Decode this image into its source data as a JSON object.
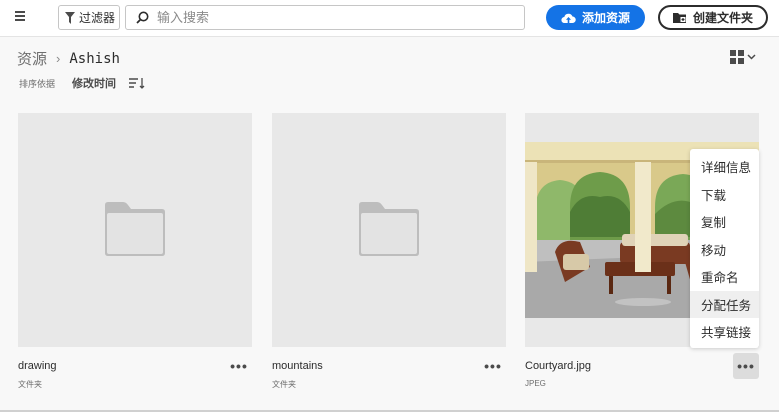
{
  "toolbar": {
    "menu_icon": "hamburger-icon",
    "filter_label": "过滤器",
    "filter_icon": "funnel-icon",
    "search_placeholder": "输入搜索",
    "search_value": "",
    "add_asset_label": "添加资源",
    "add_asset_icon": "cloud-upload-icon",
    "new_folder_label": "创建文件夹",
    "new_folder_icon": "folder-plus-icon",
    "accent_color": "#1473e6"
  },
  "breadcrumb": {
    "root": "资源",
    "current": "Ashish"
  },
  "sort": {
    "label": "排序依据",
    "value": "修改时间",
    "direction_icon": "sort-descending-icon"
  },
  "view": {
    "mode_icon": "grid-view-icon"
  },
  "cards": [
    {
      "name": "drawing",
      "type": "文件夹",
      "kind": "folder"
    },
    {
      "name": "mountains",
      "type": "文件夹",
      "kind": "folder"
    },
    {
      "name": "Courtyard.jpg",
      "type": "JPEG",
      "kind": "image"
    }
  ],
  "more_label": "•••",
  "context_menu": {
    "items": [
      "详细信息",
      "下载",
      "复制",
      "移动",
      "重命名",
      "分配任务",
      "共享链接"
    ],
    "highlighted": "分配任务"
  }
}
